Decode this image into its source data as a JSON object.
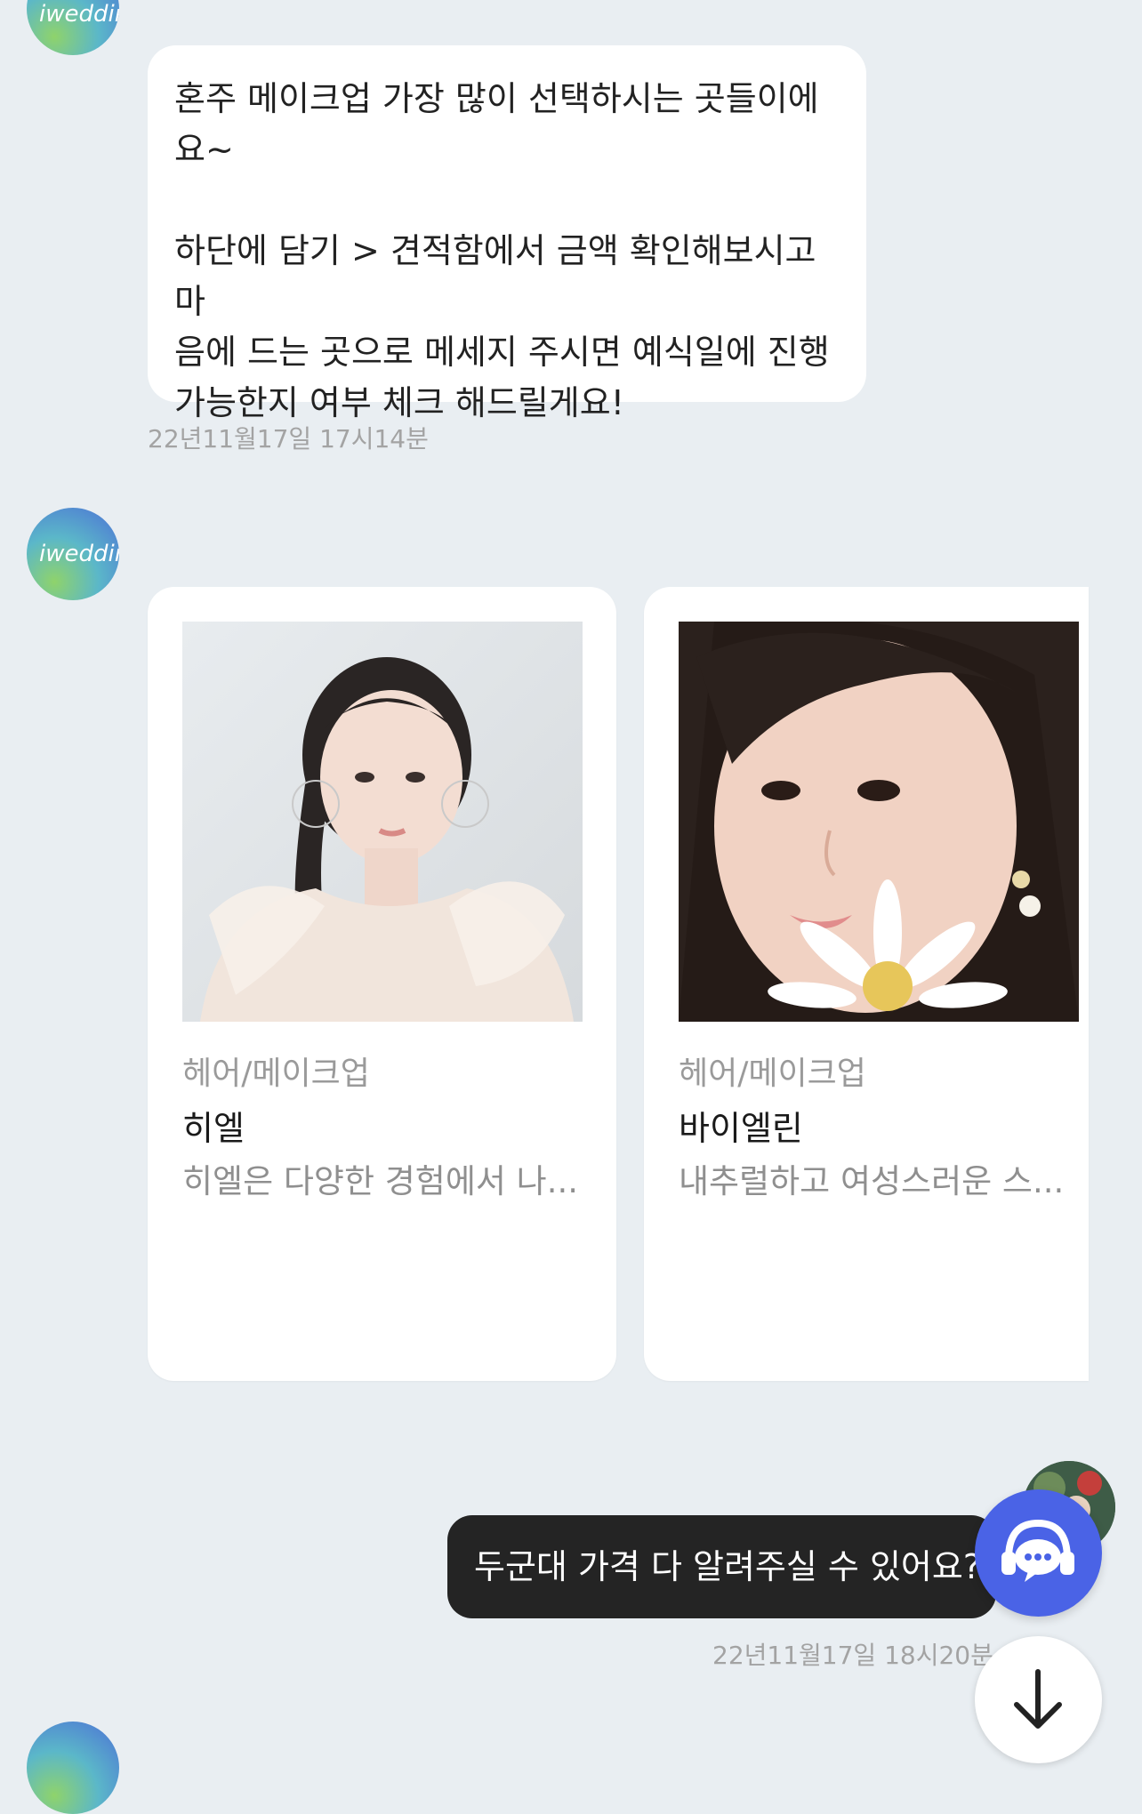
{
  "chat": {
    "bot_logo_text": "iwedding",
    "message1": {
      "line1": "혼주 메이크업 가장 많이 선택하시는 곳들이에",
      "line2": "요~",
      "line3": "하단에 담기 > 견적함에서 금액 확인해보시고 마",
      "line4": "음에 드는 곳으로 메세지 주시면 예식일에 진행",
      "line5": "가능한지 여부 체크 해드릴게요!",
      "timestamp": "22년11월17일 17시14분"
    },
    "cards": [
      {
        "category": "헤어/메이크업",
        "name": "히엘",
        "description": "히엘은 다양한 경험에서 나..."
      },
      {
        "category": "헤어/메이크업",
        "name": "바이엘린",
        "description": "내추럴하고 여성스러운 스..."
      }
    ],
    "user_message": {
      "text": "두군대 가격 다 알려주실 수 있어요?",
      "timestamp": "22년11월17일 18시20분"
    }
  },
  "colors": {
    "background": "#e9eef2",
    "support_button": "#4a63e6",
    "user_bubble": "#242424"
  },
  "icons": {
    "support": "headset-chat-icon",
    "scroll": "arrow-down-icon"
  }
}
